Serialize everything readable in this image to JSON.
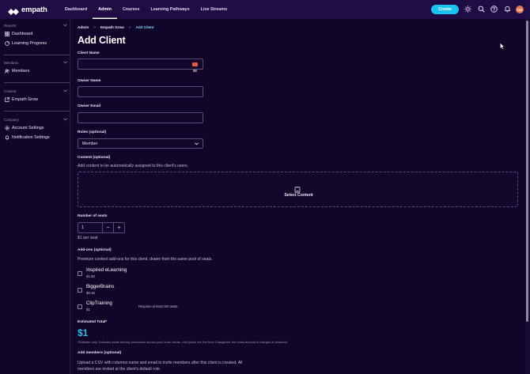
{
  "app": {
    "logo_text": "empath",
    "avatar_initials": "DR",
    "colors": {
      "topbar": "#1f0c45",
      "background": "#12052a",
      "accent": "#18c3f0",
      "avatar": "#e8794e"
    }
  },
  "nav": {
    "items": [
      {
        "label": "Dashboard"
      },
      {
        "label": "Admin"
      },
      {
        "label": "Courses"
      },
      {
        "label": "Learning Pathways"
      },
      {
        "label": "Live Streams"
      }
    ],
    "active": "Admin",
    "create_label": "Create",
    "icons": [
      "sun-icon",
      "search-icon",
      "help-icon",
      "bell-icon"
    ]
  },
  "sidebar": {
    "sections": [
      {
        "title": "Reports",
        "items": [
          {
            "label": "Dashboard",
            "icon": "grid-icon"
          },
          {
            "label": "Learning Progress",
            "icon": "progress-icon"
          }
        ]
      },
      {
        "title": "Members",
        "items": [
          {
            "label": "Members",
            "icon": "users-icon"
          }
        ]
      },
      {
        "title": "Content",
        "items": [
          {
            "label": "Empath Grow",
            "icon": "external-link-icon"
          }
        ]
      },
      {
        "title": "Company",
        "items": [
          {
            "label": "Account Settings",
            "icon": "gear-icon"
          },
          {
            "label": "Notification Settings",
            "icon": "bell-icon"
          }
        ]
      }
    ]
  },
  "breadcrumb": {
    "items": [
      "Admin",
      "Empath Grow",
      "Add Client"
    ],
    "separator": ">"
  },
  "page": {
    "title": "Add Client"
  },
  "form": {
    "client_name": {
      "label": "Client Name",
      "value": ""
    },
    "owner_name": {
      "label": "Owner Name",
      "value": ""
    },
    "owner_email": {
      "label": "Owner Email",
      "value": ""
    },
    "roles": {
      "label": "Roles (optional)",
      "value": "Member"
    },
    "content": {
      "label": "Content (optional)",
      "help": "Add content to be automatically assigned to this client's users.",
      "button_label": "Select Content"
    },
    "seats": {
      "label": "Number of seats",
      "value": "1",
      "minus": "−",
      "plus": "+",
      "price_note": "$1 per seat"
    },
    "addons": {
      "label": "Add-ons (optional)",
      "help": "Premium content add-ons for this client, drawn from the same pool of seats.",
      "items": [
        {
          "name": "Inspired eLearning",
          "price": "$1.80",
          "note": ""
        },
        {
          "name": "BiggerBrains",
          "price": "$0.36",
          "note": ""
        },
        {
          "name": "ClipTraining",
          "price": "$1",
          "note": "Requires at least 100 seats"
        }
      ]
    },
    "total": {
      "label": "Estimated Total*",
      "value": "$1",
      "footnote": "*Estimate only. Excludes seats already purchased across your Grow clients. Unit prices are live from Chargebee; the exact amount is charged at checkout."
    },
    "add_members": {
      "label": "Add members (optional)",
      "help_line1": "Upload a CSV with columns name and email to invite members after this client is created. All",
      "help_line2": "members are invited at the client's default role."
    }
  }
}
